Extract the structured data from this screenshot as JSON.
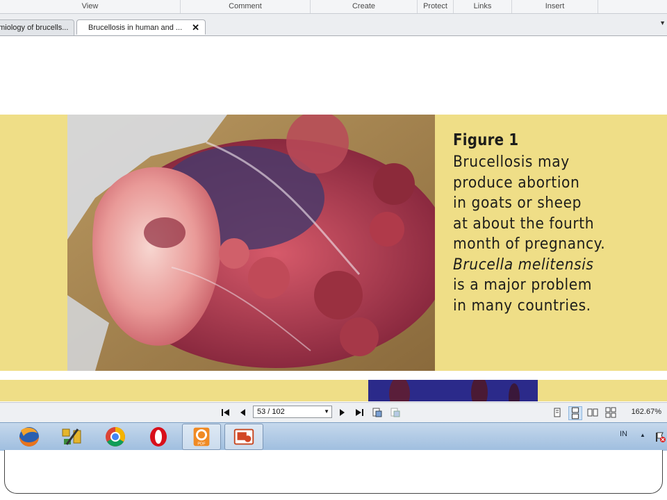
{
  "ribbon": {
    "tabs": [
      "View",
      "Comment",
      "Create",
      "Protect",
      "Links",
      "Insert"
    ]
  },
  "doc_tabs": [
    {
      "label": "emiology of brucells...",
      "active": false
    },
    {
      "label": "Brucellosis in human and ...",
      "active": true
    }
  ],
  "figure": {
    "title": "Figure 1",
    "lines": [
      {
        "text": "Brucellosis may",
        "italic": false
      },
      {
        "text": "produce abortion",
        "italic": false
      },
      {
        "text": "in goats or sheep",
        "italic": false
      },
      {
        "text": "at about the fourth",
        "italic": false
      },
      {
        "text": "month of pregnancy.",
        "italic": true,
        "partial_plain": true
      },
      {
        "text": "Brucella melitensis",
        "italic": true
      },
      {
        "text": "is a major problem",
        "italic": false
      },
      {
        "text": "in many countries.",
        "italic": false
      }
    ],
    "band_color": "#efde87"
  },
  "navbar": {
    "page_field": "53 / 102",
    "zoom": "162.67%"
  },
  "taskbar": {
    "apps": [
      "firefox-icon",
      "tools-icon",
      "chrome-icon",
      "opera-icon",
      "foxit-pdf-icon",
      "powerpoint-icon"
    ],
    "lang": "IN"
  }
}
